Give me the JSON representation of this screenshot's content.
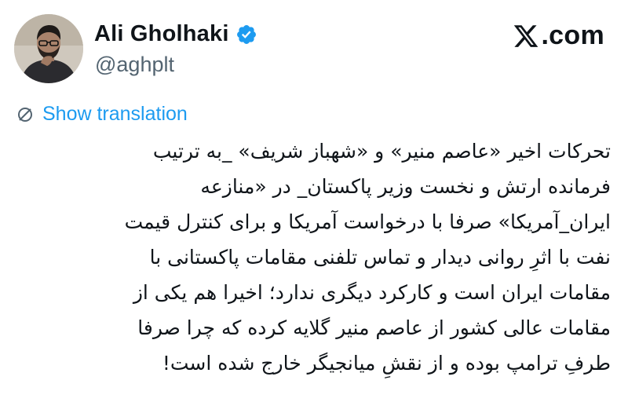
{
  "author": {
    "display_name": "Ali Gholhaki",
    "handle": "@aghplt",
    "verified_icon": "verified-badge-icon",
    "avatar_icon": "profile-avatar"
  },
  "brand": {
    "label": ".com",
    "icon": "x-logo-icon"
  },
  "translation": {
    "label": "Show translation",
    "icon": "globe-icon"
  },
  "tweet": {
    "lines": [
      "تحرکات اخیر «عاصم منیر» و «شهباز شریف» _به ترتیب",
      "فرمانده ارتش و نخست وزیر پاکستان_ در «منازعه",
      "ایران_آمریکا» صرفا با درخواست آمریکا و برای کنترل قیمت",
      "نفت با اثرِ روانی دیدار و تماس تلفنی مقامات پاکستانی با",
      "مقامات ایران است و کارکرد دیگری ندارد؛ اخیرا هم یکی از",
      "مقامات عالی کشور از عاصم منیر گلایه کرده که چرا صرفا",
      "طرفِ ترامپ بوده و از نقشِ میانجیگر خارج شده است!"
    ]
  },
  "colors": {
    "link": "#1d9bf0",
    "secondary_text": "#536471",
    "primary_text": "#0f1419",
    "background": "#ffffff"
  }
}
